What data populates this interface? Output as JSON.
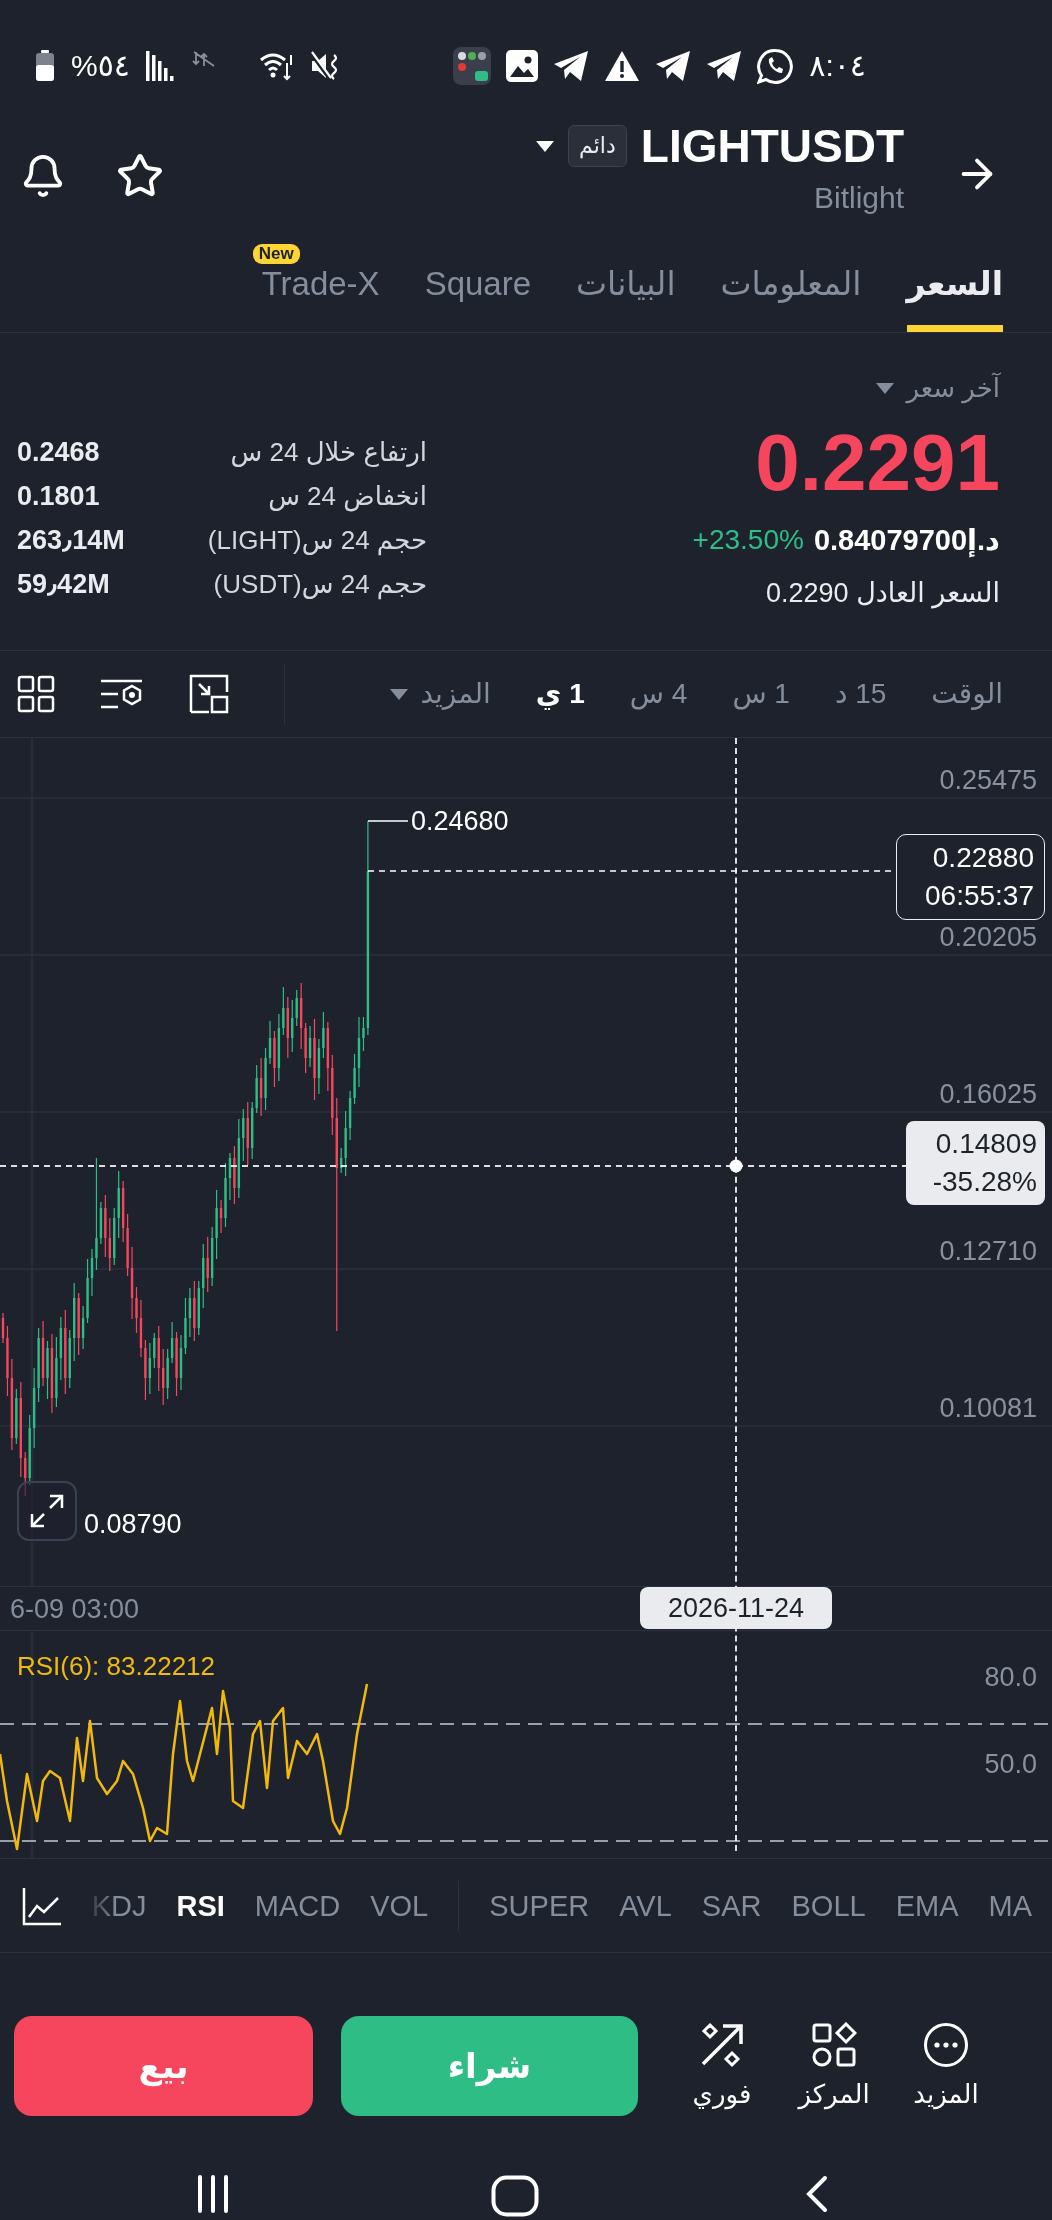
{
  "status_bar": {
    "time": "٨:٠٤",
    "battery": "%٥٤"
  },
  "header": {
    "symbol": "LIGHTUSDT",
    "badge": "دائم",
    "name": "Bitlight"
  },
  "tabs": [
    {
      "label": "السعر",
      "selected": true
    },
    {
      "label": "المعلومات",
      "selected": false
    },
    {
      "label": "البيانات",
      "selected": false
    },
    {
      "label": "Square",
      "selected": false
    },
    {
      "label": "Trade-X",
      "selected": false,
      "badge": "New"
    }
  ],
  "price": {
    "selector": "آخر سعر",
    "last": "0.2291",
    "fiat": "د.إ0.84079700",
    "change": "+23.50%",
    "fair_price": "السعر العادل 0.2290"
  },
  "stats": [
    {
      "label": "ارتفاع خلال 24 س",
      "value": "0.2468"
    },
    {
      "label": "انخفاض 24 س",
      "value": "0.1801"
    },
    {
      "label": "حجم 24 س(LIGHT)",
      "value": "263٫14M"
    },
    {
      "label": "حجم 24 س(USDT)",
      "value": "59٫42M"
    }
  ],
  "intervals": [
    {
      "label": "الوقت",
      "selected": false
    },
    {
      "label": "15 د",
      "selected": false
    },
    {
      "label": "1 س",
      "selected": false
    },
    {
      "label": "4 س",
      "selected": false
    },
    {
      "label": "1 ي",
      "selected": true
    }
  ],
  "more_intervals": "المزيد",
  "chart": {
    "price_axis": [
      "0.25475",
      "0.20205",
      "0.16025",
      "0.12710",
      "0.10081"
    ],
    "high": "0.24680",
    "low": "0.08790",
    "last_price": {
      "price": "0.22880",
      "countdown": "06:55:37"
    },
    "crosshair": {
      "price": "0.14809",
      "change": "-35.28%",
      "date": "2026-11-24"
    },
    "time_axis": "6-09 03:00"
  },
  "rsi": {
    "title": "RSI(6): 83.22212",
    "axis": [
      "80.0",
      "50.0"
    ]
  },
  "indicators": {
    "main": [
      {
        "label": "MA",
        "selected": false
      },
      {
        "label": "EMA",
        "selected": false
      },
      {
        "label": "BOLL",
        "selected": false
      },
      {
        "label": "SAR",
        "selected": false
      },
      {
        "label": "AVL",
        "selected": false
      },
      {
        "label": "SUPER",
        "selected": false
      }
    ],
    "sub": [
      {
        "label": "VOL",
        "selected": false
      },
      {
        "label": "MACD",
        "selected": false
      },
      {
        "label": "RSI",
        "selected": true
      },
      {
        "label": "KDJ",
        "selected": false
      }
    ]
  },
  "shortcuts": [
    {
      "kind": "more",
      "label": "المزيد"
    },
    {
      "kind": "positions",
      "label": "المركز"
    },
    {
      "kind": "instant",
      "label": "فوري"
    }
  ],
  "buy": "شراء",
  "sell": "بيع"
}
